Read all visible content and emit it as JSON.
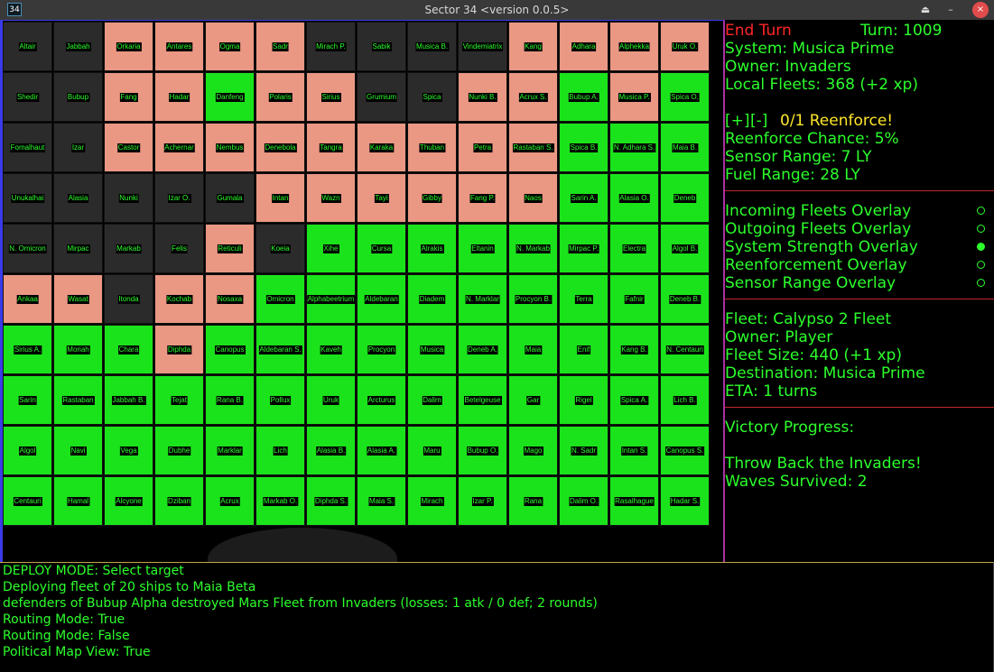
{
  "window": {
    "icon_text": "34",
    "title": "Sector 34   <version 0.0.5>",
    "buttons": {
      "up": "⏏",
      "minimize": "–",
      "close": "×"
    }
  },
  "colors": {
    "invader": "#ea9783",
    "player": "#1be31b",
    "neutral": "#2b2b2b",
    "text": "#2cff2c"
  },
  "map": {
    "rows": [
      [
        [
          "Altair",
          "n"
        ],
        [
          "Jabbah",
          "n"
        ],
        [
          "Orkaria",
          "i"
        ],
        [
          "Antares",
          "i"
        ],
        [
          "Ogma",
          "i"
        ],
        [
          "Sadr",
          "i"
        ],
        [
          "Mirach P.",
          "n"
        ],
        [
          "Sabik",
          "n"
        ],
        [
          "Musica B.",
          "n"
        ],
        [
          "Vindemiatrix",
          "n"
        ],
        [
          "Kang",
          "i"
        ],
        [
          "Adhara",
          "i"
        ],
        [
          "Alphekka",
          "i"
        ],
        [
          "Uruk O.",
          "i"
        ]
      ],
      [
        [
          "Shedir",
          "n"
        ],
        [
          "Bubup",
          "n"
        ],
        [
          "Fang",
          "i"
        ],
        [
          "Hadar",
          "i"
        ],
        [
          "Danfeng",
          "p"
        ],
        [
          "Polaris",
          "i"
        ],
        [
          "Sirius",
          "i"
        ],
        [
          "Grumium",
          "n"
        ],
        [
          "Spica",
          "n"
        ],
        [
          "Nunki B.",
          "i"
        ],
        [
          "Acrux S.",
          "i"
        ],
        [
          "Bubup A.",
          "p"
        ],
        [
          "Musica P.",
          "i"
        ],
        [
          "Spica O.",
          "p"
        ]
      ],
      [
        [
          "Fomalhaut",
          "n"
        ],
        [
          "Izar",
          "n"
        ],
        [
          "Castor",
          "i"
        ],
        [
          "Achernar",
          "i"
        ],
        [
          "Nembus",
          "i"
        ],
        [
          "Denebola",
          "i"
        ],
        [
          "Tangra",
          "i"
        ],
        [
          "Karaka",
          "i"
        ],
        [
          "Thuban",
          "i"
        ],
        [
          "Petra",
          "i"
        ],
        [
          "Rastaban S.",
          "i"
        ],
        [
          "Spica B.",
          "p"
        ],
        [
          "N. Adhara S.",
          "p"
        ],
        [
          "Maia B.",
          "p"
        ]
      ],
      [
        [
          "Unukalhai",
          "n"
        ],
        [
          "Alasia",
          "n"
        ],
        [
          "Nunki",
          "n"
        ],
        [
          "Izar O.",
          "n"
        ],
        [
          "Gumala",
          "n"
        ],
        [
          "Intan",
          "i"
        ],
        [
          "Wazn",
          "i"
        ],
        [
          "Tayi",
          "i"
        ],
        [
          "Gibby",
          "i"
        ],
        [
          "Fang P.",
          "i"
        ],
        [
          "Naos",
          "i"
        ],
        [
          "Sarin A.",
          "p"
        ],
        [
          "Alasia O.",
          "p"
        ],
        [
          "Deneb",
          "p"
        ]
      ],
      [
        [
          "N. Omicron",
          "n"
        ],
        [
          "Mirpac",
          "n"
        ],
        [
          "Markab",
          "n"
        ],
        [
          "Felis",
          "n"
        ],
        [
          "Reticuli",
          "i"
        ],
        [
          "Koeia",
          "n"
        ],
        [
          "Xihe",
          "p"
        ],
        [
          "Cursa",
          "p"
        ],
        [
          "Alrakis",
          "p"
        ],
        [
          "Eltanin",
          "p"
        ],
        [
          "N. Markab",
          "p"
        ],
        [
          "Mirpac P.",
          "p"
        ],
        [
          "Electra",
          "p"
        ],
        [
          "Algol B.",
          "p"
        ]
      ],
      [
        [
          "Ankaa",
          "i"
        ],
        [
          "Wasat",
          "i"
        ],
        [
          "Itonda",
          "n"
        ],
        [
          "Kochab",
          "i"
        ],
        [
          "Nosaxa",
          "i"
        ],
        [
          "Omicron",
          "p"
        ],
        [
          "Alphabeetrium",
          "p"
        ],
        [
          "Aldebaran",
          "p"
        ],
        [
          "Diadem",
          "p"
        ],
        [
          "N. Marklar",
          "p"
        ],
        [
          "Procyon B.",
          "p"
        ],
        [
          "Terra",
          "p"
        ],
        [
          "Fafnir",
          "p"
        ],
        [
          "Deneb B.",
          "p"
        ]
      ],
      [
        [
          "Sirius A.",
          "p"
        ],
        [
          "Moriah",
          "p"
        ],
        [
          "Chara",
          "p"
        ],
        [
          "Diphda",
          "i"
        ],
        [
          "Canopus",
          "p"
        ],
        [
          "Aldebaran S.",
          "p"
        ],
        [
          "Kaveh",
          "p"
        ],
        [
          "Procyon",
          "p"
        ],
        [
          "Musica",
          "p"
        ],
        [
          "Deneb A.",
          "p"
        ],
        [
          "Maia",
          "p"
        ],
        [
          "Enif",
          "p"
        ],
        [
          "Kang B.",
          "p"
        ],
        [
          "N. Centauri",
          "p"
        ]
      ],
      [
        [
          "Sarin",
          "p"
        ],
        [
          "Rastaban",
          "p"
        ],
        [
          "Jabbah B.",
          "p"
        ],
        [
          "Tejat",
          "p"
        ],
        [
          "Rana B.",
          "p"
        ],
        [
          "Pollux",
          "p"
        ],
        [
          "Uruk",
          "p"
        ],
        [
          "Arcturus",
          "p"
        ],
        [
          "Dalim",
          "p"
        ],
        [
          "Betelgeuse",
          "p"
        ],
        [
          "Gar",
          "p"
        ],
        [
          "Rigel",
          "p"
        ],
        [
          "Spica A.",
          "p"
        ],
        [
          "Lich B.",
          "p"
        ]
      ],
      [
        [
          "Algol",
          "p"
        ],
        [
          "Navi",
          "p"
        ],
        [
          "Vega",
          "p"
        ],
        [
          "Dubhe",
          "p"
        ],
        [
          "Marklar",
          "p"
        ],
        [
          "Lich",
          "p"
        ],
        [
          "Alasia B.",
          "p"
        ],
        [
          "Alasia A.",
          "p"
        ],
        [
          "Maru",
          "p"
        ],
        [
          "Bubup O.",
          "p"
        ],
        [
          "Mago",
          "p"
        ],
        [
          "N. Sadr",
          "p"
        ],
        [
          "Intan S.",
          "p"
        ],
        [
          "Canopus S.",
          "p"
        ]
      ],
      [
        [
          "Centauri",
          "p"
        ],
        [
          "Hamal",
          "p"
        ],
        [
          "Alcyone",
          "p"
        ],
        [
          "Dziban",
          "p"
        ],
        [
          "Acrux",
          "p"
        ],
        [
          "Markab O.",
          "p"
        ],
        [
          "Diphda S.",
          "p"
        ],
        [
          "Maia S.",
          "p"
        ],
        [
          "Mirach",
          "p"
        ],
        [
          "Izar P.",
          "p"
        ],
        [
          "Rana",
          "p"
        ],
        [
          "Dalim O.",
          "p"
        ],
        [
          "Rasalhague",
          "p"
        ],
        [
          "Hadar S."
        ]
      ]
    ]
  },
  "panel": {
    "end_turn": "End Turn",
    "turn": "Turn: 1009",
    "system": "System: Musica Prime",
    "owner": "Owner: Invaders",
    "local_fleets": "Local Fleets: 368 (+2 xp)",
    "plus": "[+]",
    "minus": "[-]",
    "reenforce": "0/1 Reenforce!",
    "reenforce_chance": "Reenforce Chance: 5%",
    "sensor_range": "Sensor Range: 7 LY",
    "fuel_range": "Fuel Range: 28 LY",
    "overlays": [
      {
        "label": "Incoming Fleets Overlay",
        "on": false
      },
      {
        "label": "Outgoing Fleets Overlay",
        "on": false
      },
      {
        "label": "System Strength Overlay",
        "on": true
      },
      {
        "label": "Reenforcement Overlay",
        "on": false
      },
      {
        "label": "Sensor Range Overlay",
        "on": false
      }
    ],
    "fleet": {
      "name": "Fleet: Calypso 2 Fleet",
      "owner": "Owner: Player",
      "size": "Fleet Size: 440 (+1 xp)",
      "destination": "Destination: Musica Prime",
      "eta": "ETA: 1 turns"
    },
    "victory": {
      "title": "Victory Progress:",
      "objective": "Throw Back the Invaders!",
      "waves": "Waves Survived: 2"
    }
  },
  "log": [
    "DEPLOY MODE: Select target",
    "Deploying fleet of 20 ships to Maia Beta",
    "defenders of Bubup Alpha destroyed Mars Fleet from Invaders (losses: 1 atk / 0 def; 2 rounds)",
    "Routing Mode: True",
    "Routing Mode: False",
    "Political Map View: True"
  ]
}
